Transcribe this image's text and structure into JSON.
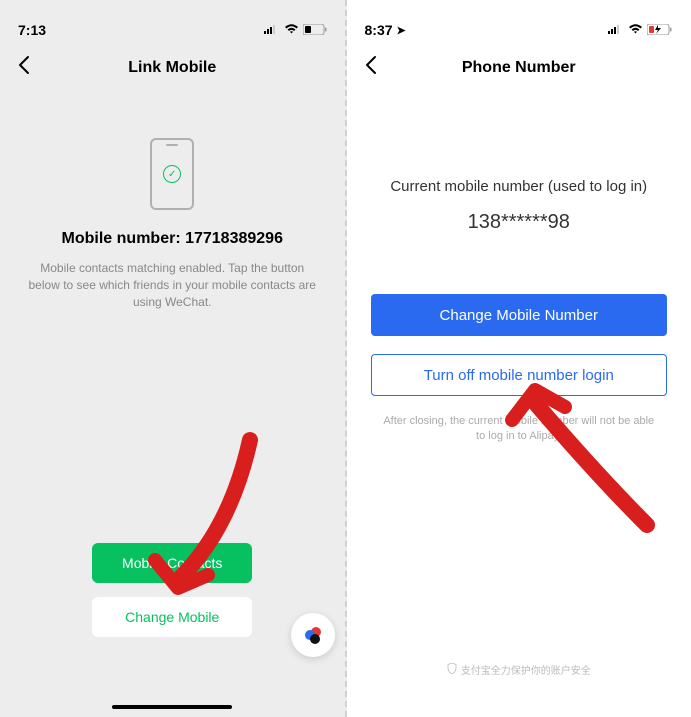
{
  "left": {
    "status_time": "7:13",
    "nav_title": "Link Mobile",
    "mobile_label": "Mobile number: 17718389296",
    "subtitle": "Mobile contacts matching enabled. Tap the button below to see which friends in your mobile contacts are using WeChat.",
    "btn_contacts": "Mobile Contacts",
    "btn_change": "Change Mobile"
  },
  "right": {
    "status_time": "8:37",
    "nav_title": "Phone Number",
    "current_label": "Current mobile number (used to log in)",
    "current_number": "138******98",
    "btn_change": "Change Mobile Number",
    "btn_turnoff": "Turn off mobile number login",
    "note": "After closing, the current mobile number will not be able to log in to Alipay.",
    "footer": "支付宝全力保护你的账户安全"
  }
}
